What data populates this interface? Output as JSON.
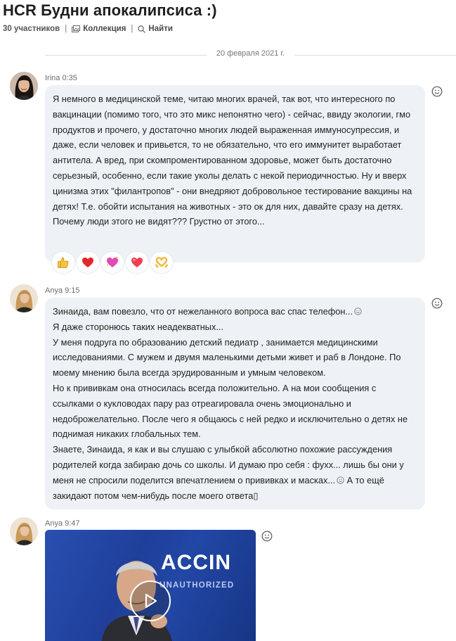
{
  "header": {
    "title": "HCR Будни апокалипсиса :)",
    "participants": "30 участников",
    "collection_label": "Коллекция",
    "find_label": "Найти"
  },
  "date_divider": "20 февраля 2021 г.",
  "messages": [
    {
      "author_line": "Irina 0:35",
      "text": "Я немного в медицинской теме, читаю многих врачей, так вот, что интересного по вакцинации (помимо того, что это микс непонятно чего) - сейчас, ввиду экологии, гмо продуктов и прочего, у достаточно многих людей выраженная иммуносупрессия, и даже, если человек и привьется, то не обязательно, что его иммунитет выработает антитела. А вред, при скомпроментированном здоровье, может быть достаточно серьезный, особенно, если такие уколы делать с некой периодичностью. Ну и вверх цинизма этих \"филантропов\" - они внедряют добровольное тестирование вакцины на детях! Т.е. обойти испытания на животных - это ок для них, давайте сразу на детях. Почему люди этого не видят??? Грустно от этого...",
      "reactions": [
        "thumbs-up",
        "red-heart",
        "sparkling-heart",
        "heart",
        "heart-hands"
      ]
    },
    {
      "author_line": "Anya 9:15",
      "lines": [
        "Зинаида, вам повезло, что от нежеланного вопроса вас спас телефон...",
        "Я даже сторонюсь таких неадекватных...",
        "У меня подруга по образованию детский педиатр , занимается медицинскими исследованиями. С мужем и двумя маленькими детьми живет и раб в Лондоне. По моему мнению была всегда эрудированным и умным человеком.",
        "Но к прививкам она относилась всегда  положительно. А на мои сообщения с ссылками о кукловодах пару раз отреагировала очень эмоционально и недоброжелательно. После чего я общаюсь с ней редко и исключительно о детях не поднимая никаких глобальных тем.",
        "Знаете, Зинаида, я как и вы слушаю с улыбкой абсолютно похожие рассуждения родителей когда забираю дочь со школы. И думаю про себя : фухх... лишь бы они у меня не спросили поделится впечатлением о прививках и масках...",
        " А то ещё закидают потом чем-нибудь после моего ответа",
        "▯"
      ]
    },
    {
      "author_line": "Anya 9:47",
      "video": {
        "overlay_title": "ACCIN",
        "overlay_subtitle": "UNAUTHORIZED"
      }
    }
  ],
  "colors": {
    "bubble_bg": "#eef2f7",
    "video_bg": "#1f3f9a",
    "text": "#222222"
  }
}
